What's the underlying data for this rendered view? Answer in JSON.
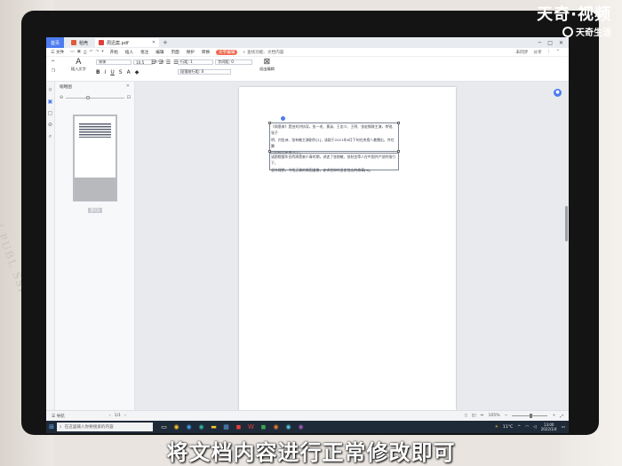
{
  "watermark": {
    "title": "天奇·视频",
    "subtitle": "天奇生活"
  },
  "subtitle": "将文档内容进行正常修改即可",
  "background": {
    "text": "Al PUBL SSIC"
  },
  "tabs": [
    {
      "label": "首页"
    },
    {
      "label": "稻壳"
    },
    {
      "label": "周迅案.pdf"
    }
  ],
  "menu": {
    "file": "三 文件",
    "items": [
      "开始",
      "插入",
      "批注",
      "编辑",
      "页面",
      "保护",
      "转换",
      "文字编辑"
    ],
    "search": "查找功能、文档内容",
    "right": [
      "未同步",
      "分享"
    ]
  },
  "ribbon": {
    "font": "宋体",
    "font_size": "10.5",
    "line_spacing_label": "行距: 1",
    "char_spacing_label": "字间距: 0",
    "para_spacing_label": "段落前行距: 0",
    "insert_text": "插入文字",
    "text_label": "文字",
    "picture": "图片",
    "exit": "退出编辑"
  },
  "thumbpanel": {
    "title": "缩略图",
    "page_label": "第1页"
  },
  "document": {
    "box1_lines": [
      "《周恩来》是由刘洪执导，张一毛、黄溪、王忠义、王明、张宏钢联主演，李锐、张子",
      "明、刘金洲、张有敏主演剧作[1]，该剧于2021年6月下旬在央视八套播出，并在腾",
      "讯视频同步播出[2]。"
    ],
    "box2_lines": [
      "该剧根据毕业的周恩来少青时期，讲述了张锐敏、张秋金等人在中国共产党的指引下，",
      "坚持理想，寻找正确的救国道路，安求信仰的坚定信念的故事[4]。"
    ]
  },
  "statusbar": {
    "nav": "导航",
    "page": "1/1",
    "zoom": "105%"
  },
  "taskbar": {
    "search_placeholder": "在这里输入你要搜索的内容",
    "weather": "11°C",
    "time": "13:00",
    "date": "2022/1/4"
  },
  "colors": {
    "accent": "#4d7cf0",
    "active_tab": "#f06a4e",
    "taskbar": "#1f2a38"
  }
}
